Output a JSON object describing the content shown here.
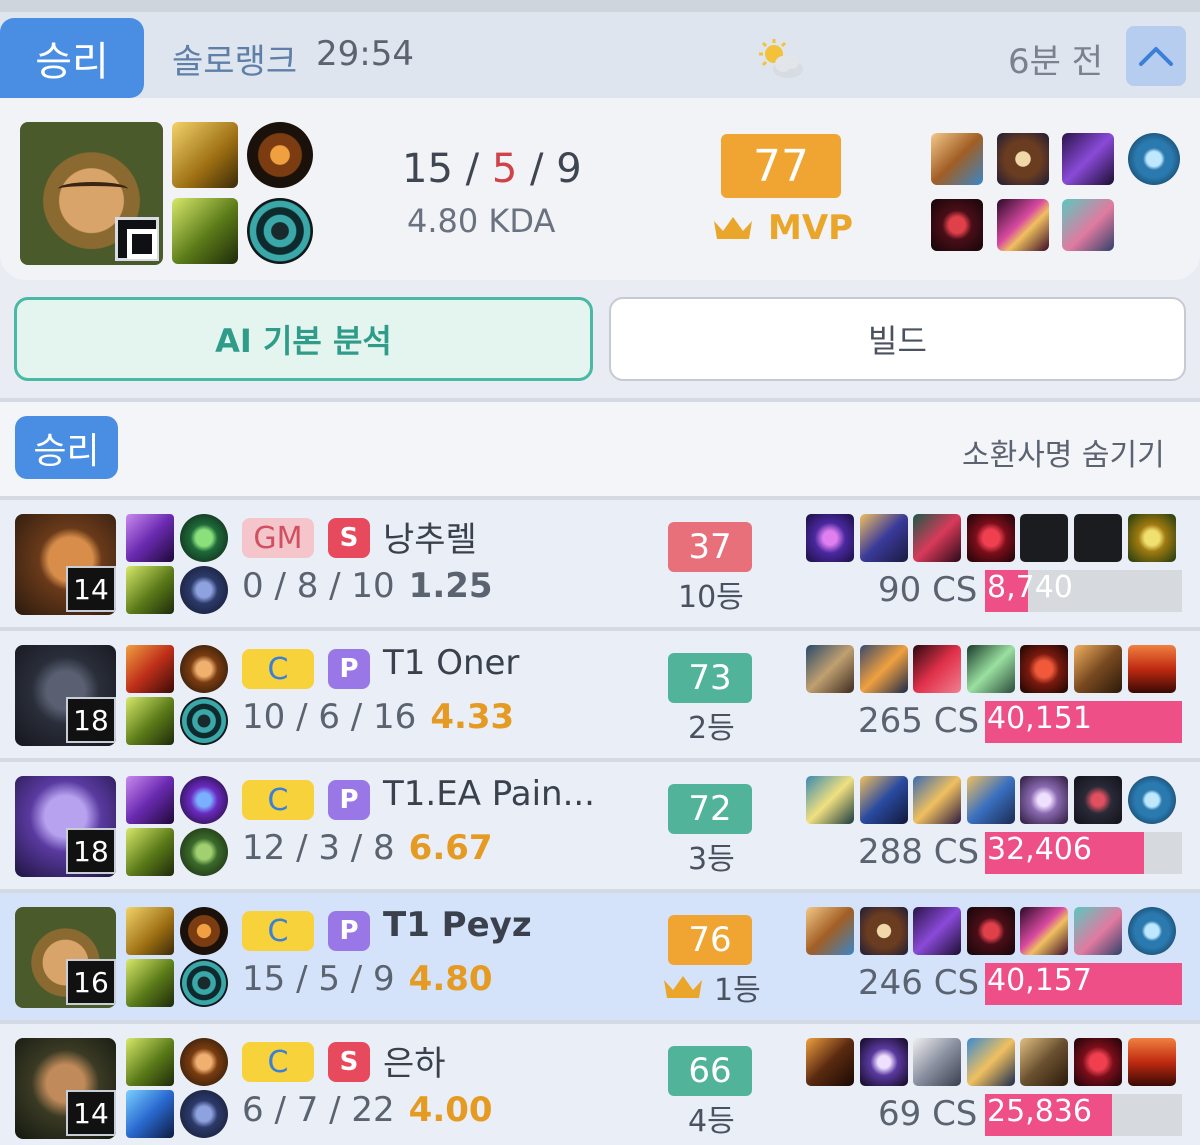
{
  "header": {
    "result": "승리",
    "queue": "솔로랭크",
    "duration": "29:54",
    "weather_icon": "partly-cloudy-icon",
    "time_ago": "6분 전",
    "collapse_icon": "chevron-up-icon"
  },
  "summary": {
    "kills": "15",
    "deaths": "5",
    "assists": "9",
    "separator": "/",
    "kda_ratio": "4.80 KDA",
    "score": "77",
    "mvp_label": "MVP"
  },
  "tabs": {
    "analysis": "AI 기본 분석",
    "build": "빌드"
  },
  "team": {
    "result": "승리",
    "hide_names": "소환사명 숨기기"
  },
  "players": [
    {
      "level": "14",
      "tier": "GM",
      "badge": "S",
      "name": "낭추렐",
      "kda": "0 / 8 / 10",
      "ratio": "1.25",
      "score": "37",
      "rank": "10등",
      "cs": "90 CS",
      "damage": "8,740",
      "damage_value": 8740
    },
    {
      "level": "18",
      "tier": "C",
      "badge": "P",
      "name": "T1 Oner",
      "kda": "10 / 6 / 16",
      "ratio": "4.33",
      "score": "73",
      "rank": "2등",
      "cs": "265 CS",
      "damage": "40,151",
      "damage_value": 40151
    },
    {
      "level": "18",
      "tier": "C",
      "badge": "P",
      "name": "T1.EA Pain...",
      "kda": "12 / 3 / 8",
      "ratio": "6.67",
      "score": "72",
      "rank": "3등",
      "cs": "288 CS",
      "damage": "32,406",
      "damage_value": 32406
    },
    {
      "level": "16",
      "tier": "C",
      "badge": "P",
      "name": "T1 Peyz",
      "kda": "15 / 5 / 9",
      "ratio": "4.80",
      "score": "76",
      "rank": "1등",
      "cs": "246 CS",
      "damage": "40,157",
      "damage_value": 40157
    },
    {
      "level": "14",
      "tier": "C",
      "badge": "S",
      "name": "은하",
      "kda": "6 / 7 / 22",
      "ratio": "4.00",
      "score": "66",
      "rank": "4등",
      "cs": "69 CS",
      "damage": "25,836",
      "damage_value": 25836
    }
  ],
  "colors": {
    "win_blue": "#4a8ee4",
    "mvp_orange": "#f0a532",
    "score_green": "#52b39b",
    "score_red": "#e8707a",
    "damage_pink": "#ee4f86",
    "death_red": "#d0424a"
  }
}
